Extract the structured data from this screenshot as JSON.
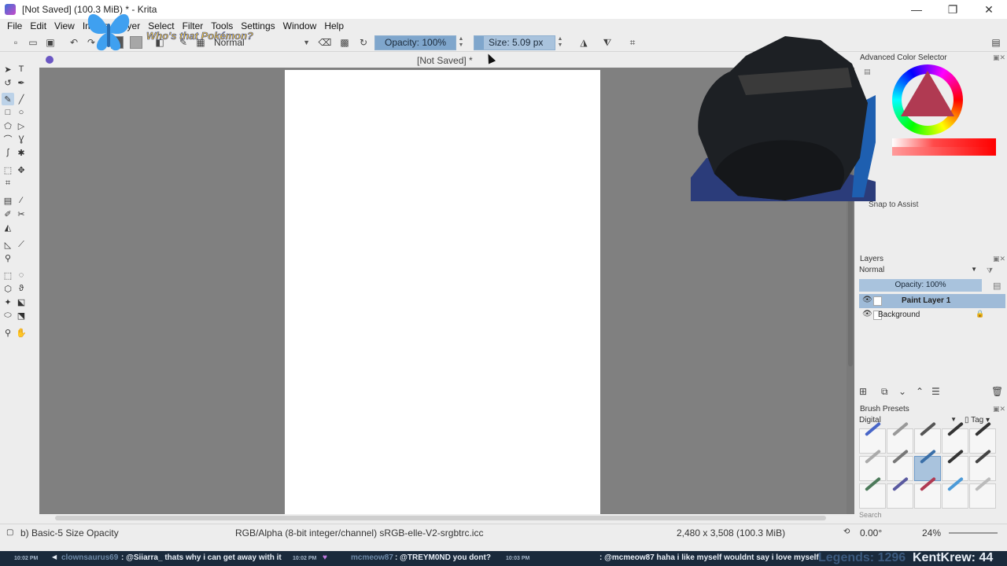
{
  "window": {
    "title": "[Not Saved]  (100.3 MiB)  * - Krita",
    "minimize": "—",
    "maximize": "❐",
    "close": "✕"
  },
  "menu": [
    "File",
    "Edit",
    "View",
    "Image",
    "Layer",
    "Select",
    "Filter",
    "Tools",
    "Settings",
    "Window",
    "Help"
  ],
  "tool_options": {
    "blend_mode": "Normal",
    "opacity_label": "Opacity: 100%",
    "size_label": "Size: 5.09 px",
    "opacity_fraction": 1.0,
    "size_fraction": 0.12
  },
  "canvas": {
    "tab_title": "[Not Saved]  *"
  },
  "dockers": {
    "color_selector_title": "Advanced Color Selector",
    "snap_label": "Snap to Assist",
    "layers_title": "Layers",
    "layers_blend": "Normal",
    "layers_opacity": "Opacity:  100%",
    "layers": [
      {
        "name": "Paint Layer 1",
        "selected": true
      },
      {
        "name": "Background",
        "selected": false
      }
    ],
    "brush_presets_title": "Brush Presets",
    "brush_filter": "Digital",
    "brush_tag": "Tag",
    "search_placeholder": "Search"
  },
  "status": {
    "brush": "b) Basic-5 Size Opacity",
    "color_space": "RGB/Alpha (8-bit integer/channel)  sRGB-elle-V2-srgbtrc.icc",
    "dimensions": "2,480 x 3,508 (100.3 MiB)",
    "rotation": "0.00°",
    "zoom": "24%"
  },
  "overlay": {
    "whos_that": "Who's that Pokémon?",
    "ticker": [
      {
        "time": "10:02 PM",
        "user": "clownsaurus69",
        "msg": ": @Siiarra_ thats why i can get away with it"
      },
      {
        "time": "10:02 PM",
        "user": "mcmeow87",
        "msg": ": @TREYM0ND you dont?"
      },
      {
        "time": "10:03 PM",
        "user": "",
        "msg": ": @mcmeow87 haha i like myself wouldnt say i love myself"
      }
    ],
    "legends_label": "Legends: 1296",
    "kentkrew_label": "KentKrew: 44"
  },
  "colors": {
    "accent": "#a9c3dd",
    "canvas_bg": "#808080",
    "paper": "#ffffff",
    "ticker_bg": "#1a2a3c"
  }
}
